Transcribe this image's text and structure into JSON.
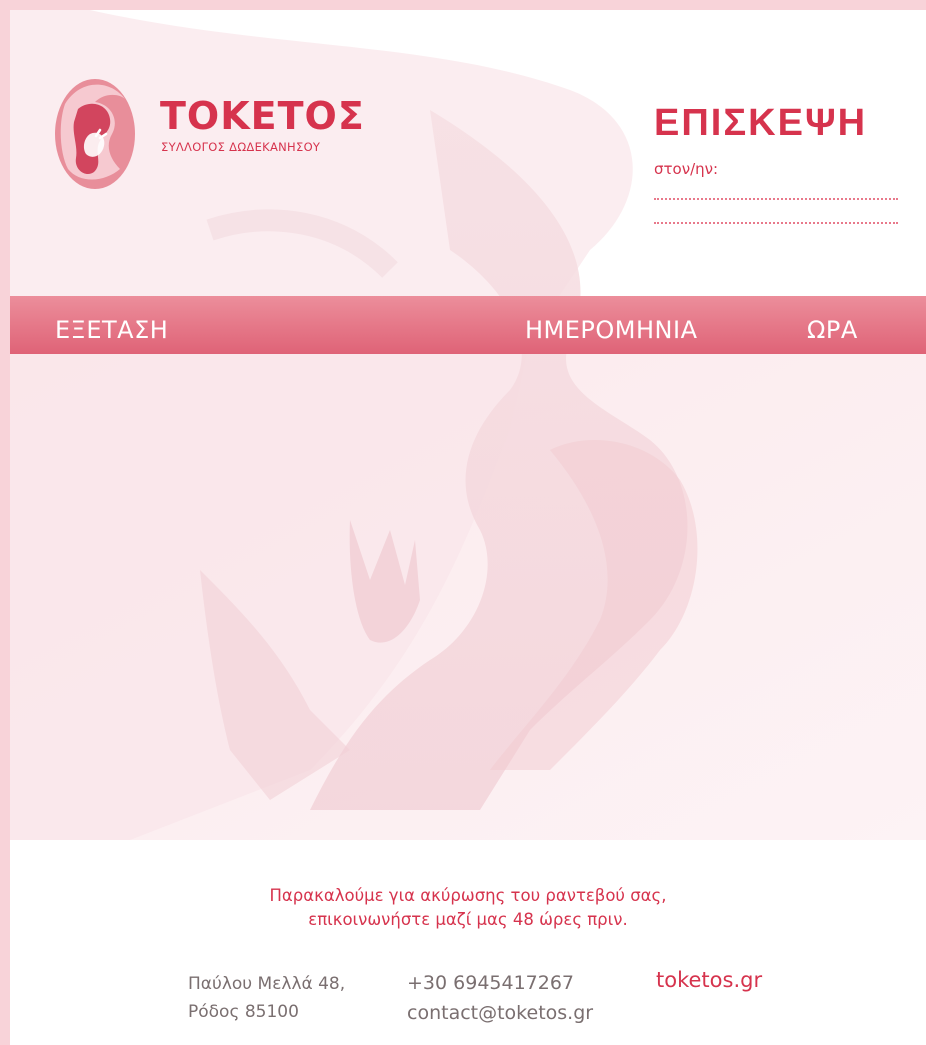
{
  "brand": {
    "name": "ΤΟΚΕΤΟΣ",
    "subtitle": "ΣΥΛΛΟΓΟΣ ΔΩΔΕΚΑΝΗΣΟΥ",
    "color": "#d6334d"
  },
  "visit": {
    "title": "ΕΠΙΣΚΕΨΗ",
    "to_label": "στον/ην:"
  },
  "table_header": {
    "exam": "ΕΞΕΤΑΣΗ",
    "date": "ΗΜΕΡΟΜΗΝΙΑ",
    "time": "ΩΡΑ"
  },
  "notice": {
    "line1": "Παρακαλούμε για ακύρωσης του ραντεβού σας,",
    "line2": "επικοινωνήστε μαζί μας 48 ώρες πριν."
  },
  "contact": {
    "address_line1": "Παύλου Μελλά 48,",
    "address_line2": "Ρόδος 85100",
    "phone": "+30 6945417267",
    "email": "contact@toketos.gr",
    "website": "toketos.gr"
  },
  "colors": {
    "background": "#f8d3d9",
    "accent": "#d6334d",
    "bar_gradient_top": "#ec8e9b",
    "bar_gradient_bottom": "#df6377",
    "muted_text": "#7a6f70"
  }
}
